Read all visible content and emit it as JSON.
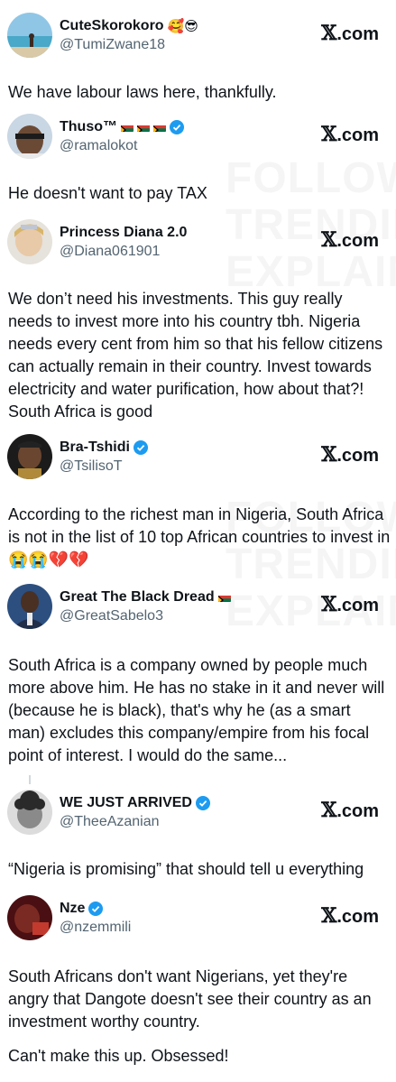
{
  "brand": {
    "label": "com",
    "x_glyph": "𝕏"
  },
  "watermark": {
    "lines": [
      "FOLLOW",
      "TRENDING",
      "EXPLAINED"
    ]
  },
  "tweets": [
    {
      "name": "CuteSkorokoro",
      "emoji": "🥰😎",
      "handle": "@TumiZwane18",
      "verified": false,
      "text": "We have labour laws here, thankfully."
    },
    {
      "name": "Thuso™",
      "handle": "@ramalokot",
      "verified": true,
      "flags": 3,
      "text": "He doesn't want to pay TAX"
    },
    {
      "name": "Princess Diana 2.0",
      "handle": "@Diana061901",
      "verified": false,
      "text": "We don’t need his investments. This guy really needs to invest more into his country tbh. Nigeria needs every cent from him so that his fellow citizens can actually remain in their country. Invest towards electricity and water purification, how about that?! South Africa is good"
    },
    {
      "name": "Bra-Tshidi",
      "handle": "@TsilisoT",
      "verified": true,
      "text": "According to the richest man in Nigeria, South Africa is not in the list of 10 top African countries to invest in 😭😭💔💔"
    },
    {
      "name": "Great The Black Dread",
      "handle": "@GreatSabelo3",
      "verified": false,
      "flags": 1,
      "text": "South Africa is a company owned by people much more above him. He has no stake in it and never will (because he is black), that's why he (as a smart man) excludes this company/empire from his focal point of interest. I would do the same..."
    },
    {
      "name": "WE JUST ARRIVED",
      "handle": "@TheeAzanian",
      "verified": true,
      "text": "“Nigeria is promising” that should tell u everything"
    },
    {
      "name": "Nze",
      "handle": "@nzemmili",
      "verified": true,
      "text": "South Africans don't want Nigerians, yet they're angry that Dangote doesn't see their country as an investment worthy country.",
      "text2": "Can't make this up. Obsessed!"
    }
  ],
  "colors": {
    "verified": "#1d9bf0",
    "handle": "#536471",
    "text": "#0f1419"
  }
}
